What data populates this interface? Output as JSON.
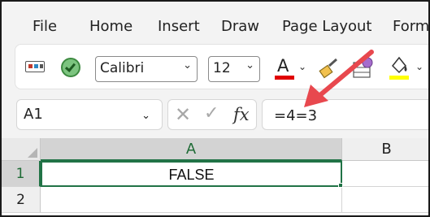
{
  "menu": {
    "tabs": [
      "File",
      "Home",
      "Insert",
      "Draw",
      "Page Layout",
      "Form"
    ]
  },
  "ribbon": {
    "font_name": "Calibri",
    "font_size": "12",
    "font_color_glyph": "A",
    "font_color": "#e00000",
    "highlight_color": "#ffff00"
  },
  "formula_bar": {
    "name_box": "A1",
    "cancel_glyph": "✕",
    "enter_glyph": "✓",
    "fx_glyph": "fx",
    "formula": "=4=3"
  },
  "sheet": {
    "columns": [
      "A",
      "B"
    ],
    "rows": [
      "1",
      "2"
    ],
    "cells": {
      "A1": "FALSE"
    }
  },
  "annotation": {
    "arrow_color": "#e8484e"
  }
}
